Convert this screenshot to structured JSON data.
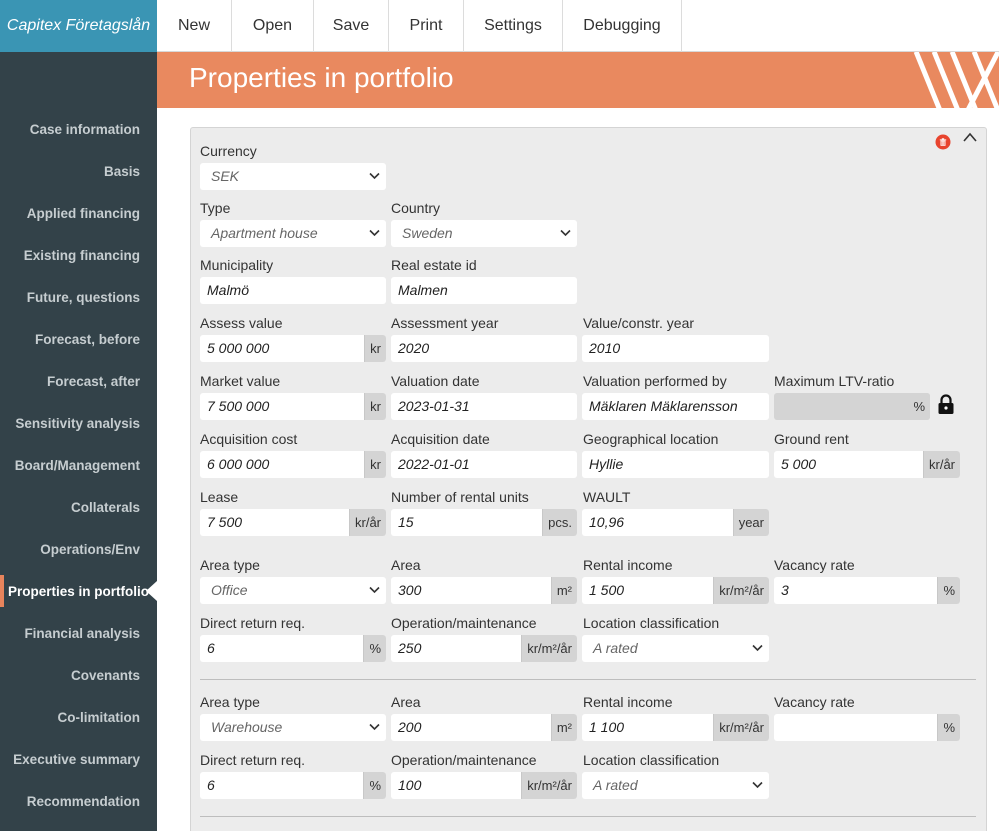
{
  "app": {
    "title": "Capitex Företagslån"
  },
  "menu": [
    "New",
    "Open",
    "Save",
    "Print",
    "Settings",
    "Debugging"
  ],
  "sidebar": {
    "items": [
      "Case information",
      "Basis",
      "Applied financing",
      "Existing financing",
      "Future, questions",
      "Forecast, before",
      "Forecast, after",
      "Sensitivity analysis",
      "Board/Management",
      "Collaterals",
      "Operations/Env",
      "Properties in portfolio",
      "Financial analysis",
      "Covenants",
      "Co-limitation",
      "Executive summary",
      "Recommendation"
    ],
    "active": "Properties in portfolio"
  },
  "page": {
    "title": "Properties in portfolio"
  },
  "form": {
    "currency": {
      "label": "Currency",
      "value": "SEK"
    },
    "type": {
      "label": "Type",
      "value": "Apartment house"
    },
    "country": {
      "label": "Country",
      "value": "Sweden"
    },
    "municipality": {
      "label": "Municipality",
      "value": "Malmö"
    },
    "real_estate_id": {
      "label": "Real estate id",
      "value": "Malmen"
    },
    "assess_value": {
      "label": "Assess value",
      "value": "5 000 000",
      "unit": "kr"
    },
    "assessment_year": {
      "label": "Assessment year",
      "value": "2020"
    },
    "value_constr_year": {
      "label": "Value/constr. year",
      "value": "2010"
    },
    "market_value": {
      "label": "Market value",
      "value": "7 500 000",
      "unit": "kr"
    },
    "valuation_date": {
      "label": "Valuation date",
      "value": "2023-01-31"
    },
    "valuation_by": {
      "label": "Valuation performed by",
      "value": "Mäklaren Mäklarensson"
    },
    "max_ltv": {
      "label": "Maximum LTV-ratio",
      "value": "",
      "unit": "%"
    },
    "acquisition_cost": {
      "label": "Acquisition cost",
      "value": "6 000 000",
      "unit": "kr"
    },
    "acquisition_date": {
      "label": "Acquisition date",
      "value": "2022-01-01"
    },
    "geo_location": {
      "label": "Geographical location",
      "value": "Hyllie"
    },
    "ground_rent": {
      "label": "Ground rent",
      "value": "5 000",
      "unit": "kr/år"
    },
    "lease": {
      "label": "Lease",
      "value": "7 500",
      "unit": "kr/år"
    },
    "rental_units": {
      "label": "Number of rental units",
      "value": "15",
      "unit": "pcs."
    },
    "wault": {
      "label": "WAULT",
      "value": "10,96",
      "unit": "year"
    }
  },
  "labels": {
    "area_type": "Area type",
    "area": "Area",
    "rental_income": "Rental income",
    "vacancy_rate": "Vacancy rate",
    "direct_return": "Direct return req.",
    "operation": "Operation/maintenance",
    "location_class": "Location classification"
  },
  "units": {
    "area": "m²",
    "rent": "kr/m²/år",
    "percent": "%",
    "opex": "kr/m²/år"
  },
  "areas": [
    {
      "type": "Office",
      "area": "300",
      "rental_income": "1 500",
      "vacancy_rate": "3",
      "direct_return": "6",
      "operation": "250",
      "location": "A rated"
    },
    {
      "type": "Warehouse",
      "area": "200",
      "rental_income": "1 100",
      "vacancy_rate": "",
      "direct_return": "6",
      "operation": "100",
      "location": "A rated"
    }
  ],
  "colors": {
    "brand": "#3a95b4",
    "sidebar": "#334249",
    "header": "#e9895f",
    "card": "#ececec",
    "delete": "#e8442e"
  },
  "icons": {
    "delete": "trash-icon",
    "collapse": "chevron-up-icon",
    "lock": "lock-icon",
    "dropdown": "chevron-down-icon"
  }
}
